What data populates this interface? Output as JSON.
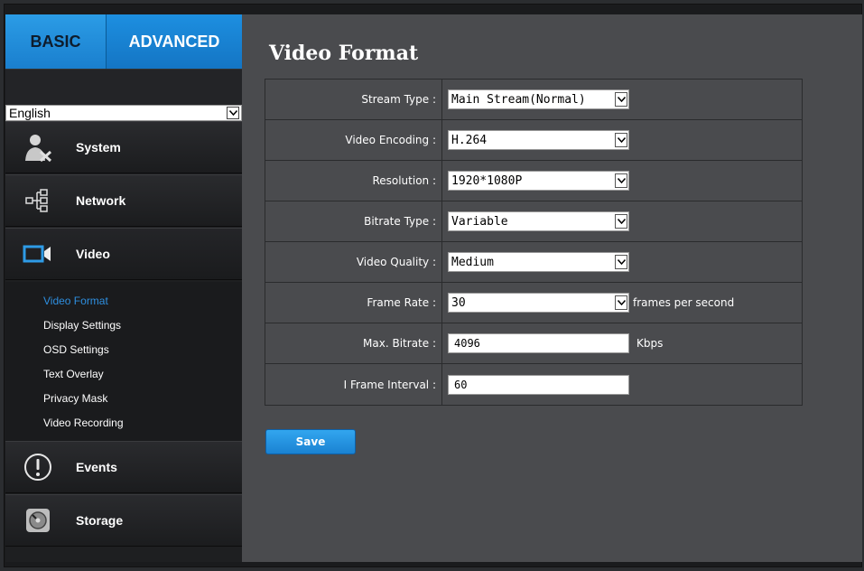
{
  "tabs": {
    "basic": "BASIC",
    "advanced": "ADVANCED"
  },
  "language": {
    "selected": "English"
  },
  "nav": [
    {
      "label": "System",
      "icon": "system-admin-icon"
    },
    {
      "label": "Network",
      "icon": "network-tree-icon"
    },
    {
      "label": "Video",
      "icon": "video-camera-icon"
    },
    {
      "label": "Events",
      "icon": "alert-exclamation-icon"
    },
    {
      "label": "Storage",
      "icon": "storage-disk-icon"
    }
  ],
  "subnav": [
    {
      "label": "Video Format",
      "active": true
    },
    {
      "label": "Display Settings"
    },
    {
      "label": "OSD Settings"
    },
    {
      "label": "Text Overlay"
    },
    {
      "label": "Privacy Mask"
    },
    {
      "label": "Video Recording"
    }
  ],
  "page": {
    "title": "Video Format"
  },
  "form": {
    "stream_type": {
      "label": "Stream Type :",
      "value": "Main Stream(Normal)"
    },
    "video_encoding": {
      "label": "Video Encoding :",
      "value": "H.264"
    },
    "resolution": {
      "label": "Resolution :",
      "value": "1920*1080P"
    },
    "bitrate_type": {
      "label": "Bitrate Type :",
      "value": "Variable"
    },
    "video_quality": {
      "label": "Video Quality :",
      "value": "Medium"
    },
    "frame_rate": {
      "label": "Frame Rate :",
      "value": "30",
      "unit": "frames per second"
    },
    "max_bitrate": {
      "label": "Max. Bitrate :",
      "value": "4096",
      "unit": "Kbps"
    },
    "i_frame_interval": {
      "label": "I Frame Interval :",
      "value": "60"
    }
  },
  "buttons": {
    "save": "Save"
  },
  "colors": {
    "accent": "#1d8fe0",
    "active_sub": "#2e8fe0",
    "panel": "#4a4b4e"
  }
}
